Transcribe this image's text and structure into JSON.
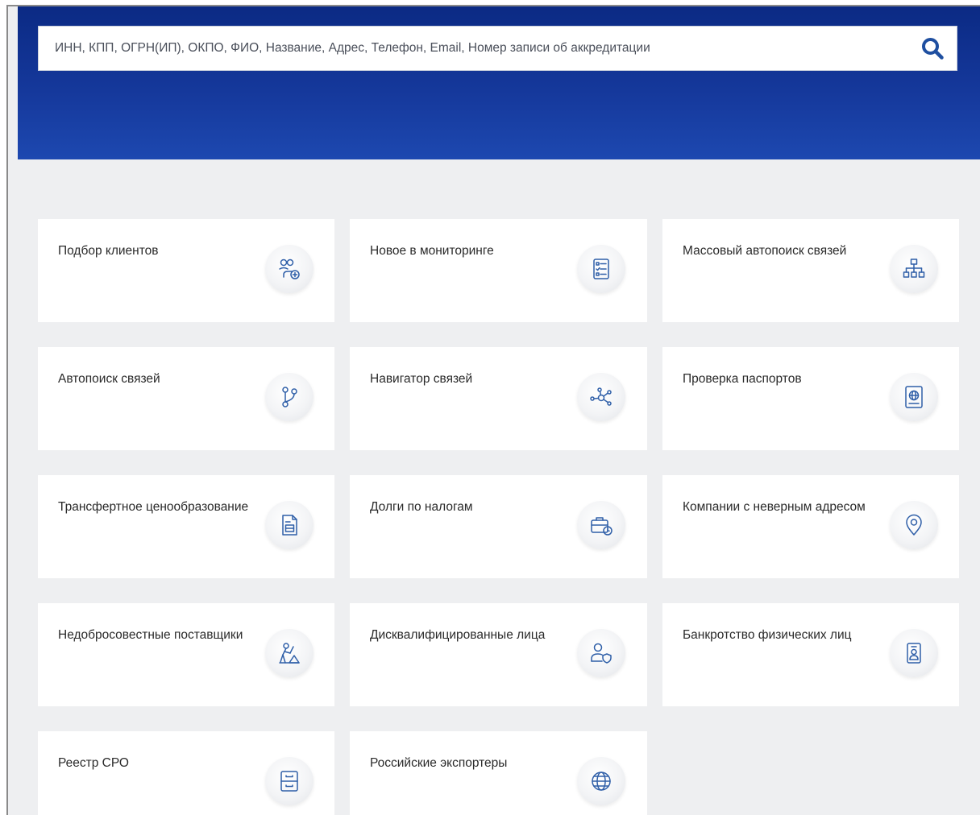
{
  "search": {
    "placeholder": "ИНН, КПП, ОГРН(ИП), ОКПО, ФИО, Название, Адрес, Телефон, Email, Номер записи об аккредитации"
  },
  "tiles": [
    {
      "label": "Подбор клиентов",
      "icon": "add-users-icon"
    },
    {
      "label": "Новое в мониторинге",
      "icon": "checklist-icon"
    },
    {
      "label": "Массовый автопоиск связей",
      "icon": "org-chart-icon"
    },
    {
      "label": "Автопоиск связей",
      "icon": "branch-icon"
    },
    {
      "label": "Навигатор связей",
      "icon": "network-icon"
    },
    {
      "label": "Проверка паспортов",
      "icon": "passport-icon"
    },
    {
      "label": "Трансфертное ценообразование",
      "icon": "document-icon"
    },
    {
      "label": "Долги по налогам",
      "icon": "briefcase-clock-icon"
    },
    {
      "label": "Компании с неверным адресом",
      "icon": "location-pin-icon"
    },
    {
      "label": "Недобросовестные поставщики",
      "icon": "worker-icon"
    },
    {
      "label": "Дисквалифицированные лица",
      "icon": "user-shield-icon"
    },
    {
      "label": "Банкротство физических лиц",
      "icon": "id-badge-icon"
    },
    {
      "label": "Реестр СРО",
      "icon": "cabinet-icon"
    },
    {
      "label": "Российские экспортеры",
      "icon": "globe-icon"
    }
  ],
  "colors": {
    "header_dark": "#0b2a84",
    "header_light": "#1d48b0",
    "icon_blue": "#2f5fa8",
    "search_icon": "#1f4fa0",
    "background": "#eeeff1"
  }
}
